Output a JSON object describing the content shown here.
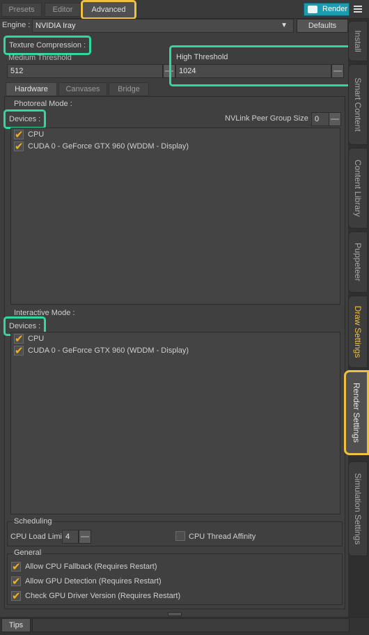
{
  "top_tabs": {
    "presets": "Presets",
    "editor": "Editor",
    "advanced": "Advanced"
  },
  "render_button": "Render",
  "engine": {
    "label": "Engine :",
    "value": "NVIDIA Iray",
    "defaults": "Defaults"
  },
  "texture": {
    "title": "Texture Compression :",
    "medium_label": "Medium Threshold",
    "medium_value": "512",
    "high_label": "High Threshold",
    "high_value": "1024"
  },
  "inner_tabs": {
    "hardware": "Hardware",
    "canvases": "Canvases",
    "bridge": "Bridge"
  },
  "photoreal": {
    "title": "Photoreal Mode :",
    "devices_label": "Devices :",
    "nvlink_label": "NVLink Peer Group Size :",
    "nvlink_value": "0",
    "devices": [
      "CPU",
      "CUDA 0 - GeForce GTX 960 (WDDM - Display)"
    ]
  },
  "interactive": {
    "title": "Interactive Mode :",
    "devices_label": "Devices :",
    "devices": [
      "CPU",
      "CUDA 0 - GeForce GTX 960 (WDDM - Display)"
    ]
  },
  "scheduling": {
    "title": "Scheduling",
    "cpu_load_label": "CPU Load Limit",
    "cpu_load_value": "4",
    "thread_affinity": "CPU Thread Affinity"
  },
  "general": {
    "title": "General",
    "options": [
      "Allow CPU Fallback (Requires Restart)",
      "Allow GPU Detection (Requires Restart)",
      "Check GPU Driver Version (Requires Restart)"
    ]
  },
  "side_tabs": [
    "Install",
    "Smart Content",
    "Content Library",
    "Puppeteer",
    "Draw Settings",
    "Render Settings",
    "Simulation Settings"
  ],
  "bottom": {
    "tips": "Tips"
  },
  "colors": {
    "highlight_yellow": "#f0c040",
    "highlight_green": "#2fd8a0",
    "render_button": "#1a9cb0",
    "check": "#f0b020"
  }
}
